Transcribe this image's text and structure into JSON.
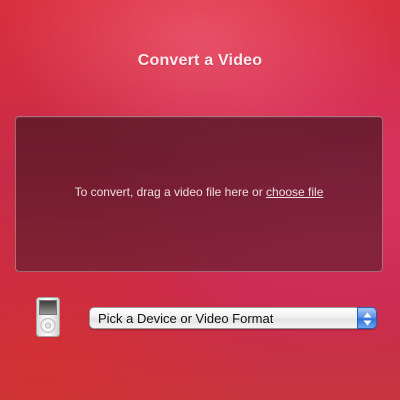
{
  "title": "Convert a Video",
  "dropzone": {
    "prefix": "To convert, drag a video file here or ",
    "link_label": "choose file"
  },
  "device": {
    "icon": "ipod-icon"
  },
  "format_select": {
    "selected": "Pick a Device or Video Format",
    "icon": "up-down-arrows-icon"
  }
}
